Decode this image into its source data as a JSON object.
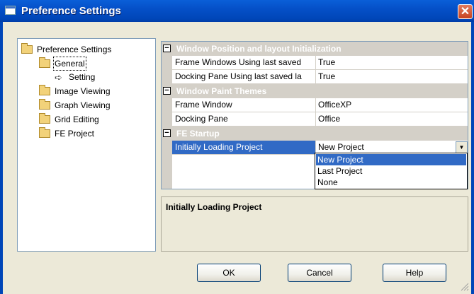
{
  "window": {
    "title": "Preference Settings"
  },
  "tree": {
    "root": "Preference Settings",
    "items": [
      {
        "label": "General"
      },
      {
        "label": "Setting"
      },
      {
        "label": "Image Viewing"
      },
      {
        "label": "Graph Viewing"
      },
      {
        "label": "Grid Editing"
      },
      {
        "label": "FE Project"
      }
    ]
  },
  "grid": {
    "categories": [
      {
        "name": "Window Position and layout Initialization",
        "rows": [
          {
            "name": "Frame Windows Using last saved",
            "value": "True"
          },
          {
            "name": "Docking Pane Using last saved la",
            "value": "True"
          }
        ]
      },
      {
        "name": "Window Paint Themes",
        "rows": [
          {
            "name": "Frame Window",
            "value": "OfficeXP"
          },
          {
            "name": "Docking Pane",
            "value": "Office"
          }
        ]
      },
      {
        "name": "FE Startup",
        "rows": [
          {
            "name": "Initially Loading Project",
            "value": "New Project"
          }
        ]
      }
    ],
    "dropdown_options": [
      "New Project",
      "Last Project",
      "None"
    ]
  },
  "description": {
    "title": "Initially Loading Project"
  },
  "buttons": {
    "ok": "OK",
    "cancel": "Cancel",
    "help": "Help"
  },
  "icons": {
    "expanded_box": "minus-box",
    "close": "close-icon",
    "tree_arrow": "arrow-icon",
    "folder": "folder-icon"
  }
}
